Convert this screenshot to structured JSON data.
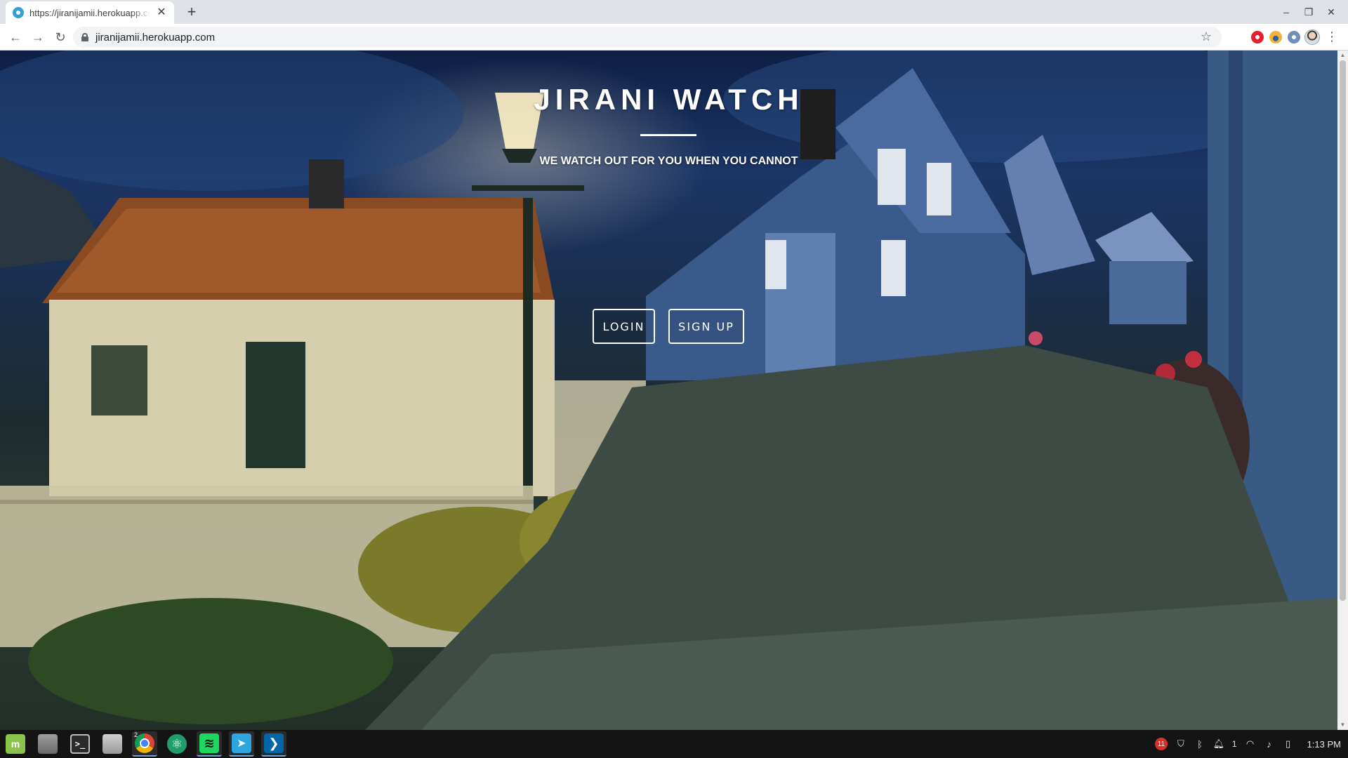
{
  "browser": {
    "tab_title": "https://jiranijamii.herokuapp.com",
    "tab_close": "✕",
    "new_tab": "+",
    "url": "jiranijamii.herokuapp.com",
    "back": "←",
    "forward": "→",
    "reload": "↻",
    "star": "☆",
    "menu": "⋮",
    "window_controls": {
      "minimize": "–",
      "restore": "❐",
      "close": "✕"
    },
    "extensions": [
      "opera-icon",
      "ghostery-icon",
      "extension-icon"
    ]
  },
  "hero": {
    "title": "JIRANI WATCH",
    "subtitle": "WE WATCH OUT FOR YOU WHEN YOU CANNOT",
    "login_label": "LOGIN",
    "signup_label": "SIGN UP"
  },
  "taskbar": {
    "apps": [
      "mint-menu-icon",
      "files-show-desktop-icon",
      "terminal-icon",
      "file-manager-icon",
      "chrome-icon",
      "atom-icon",
      "spotify-icon",
      "telegram-icon",
      "vscode-icon"
    ],
    "chrome_badge": "2",
    "tray_badge": "11",
    "tray_count": "1",
    "clock": "1:13 PM"
  },
  "colors": {
    "accent": "#ffffff",
    "taskbar": "#141414",
    "chrome_tab": "#dee1e6"
  }
}
